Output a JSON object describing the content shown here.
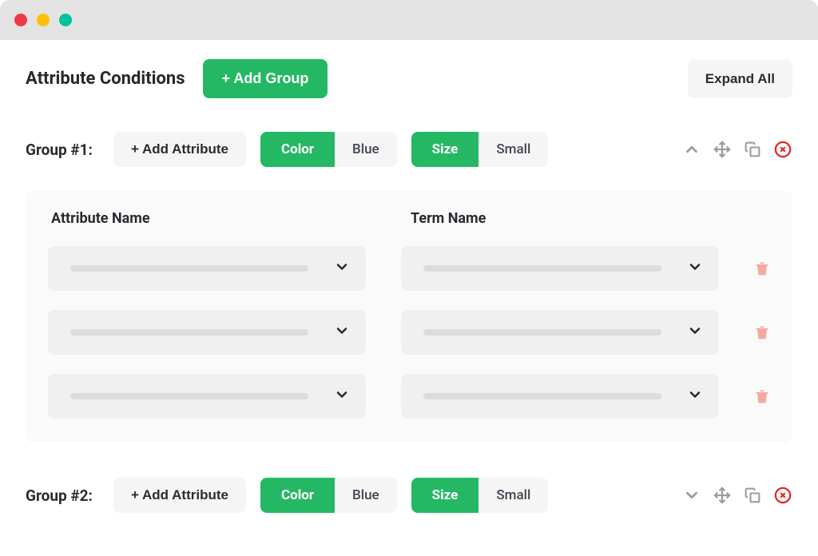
{
  "header": {
    "title": "Attribute Conditions",
    "add_group_label": "+ Add Group",
    "expand_all_label": "Expand All"
  },
  "groups": [
    {
      "label": "Group #1:",
      "add_attribute_label": "+ Add Attribute",
      "chips": [
        {
          "attr": "Color",
          "term": "Blue"
        },
        {
          "attr": "Size",
          "term": "Small"
        }
      ],
      "expanded": true
    },
    {
      "label": "Group #2:",
      "add_attribute_label": "+ Add Attribute",
      "chips": [
        {
          "attr": "Color",
          "term": "Blue"
        },
        {
          "attr": "Size",
          "term": "Small"
        }
      ],
      "expanded": false
    }
  ],
  "panel": {
    "col1_header": "Attribute Name",
    "col2_header": "Term Name",
    "rows": 3
  }
}
